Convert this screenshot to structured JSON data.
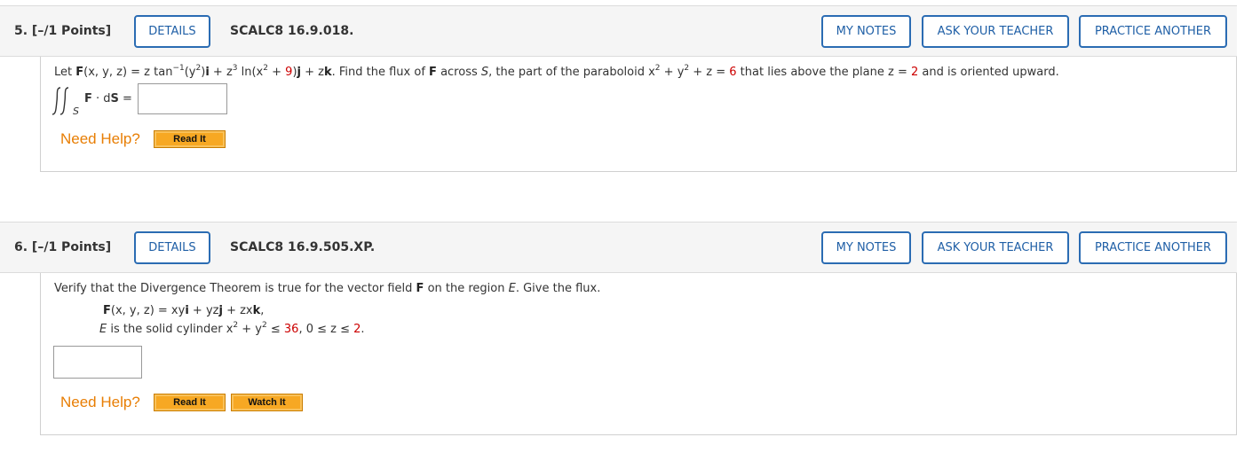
{
  "q5": {
    "number": "5.  [–/1 Points]",
    "details": "DETAILS",
    "id": "SCALC8 16.9.018.",
    "my_notes": "MY NOTES",
    "ask_teacher": "ASK YOUR TEACHER",
    "practice": "PRACTICE ANOTHER",
    "text": {
      "let": "Let ",
      "F": "F",
      "args": "(x, y, z) = z tan",
      "sup_m1": "−1",
      "y2a": "(y",
      "sup2": "2",
      "after_y2": ")",
      "i": "i",
      "plus_z": " + z",
      "sup3": "3",
      "ln": " ln(x",
      "plus": " + ",
      "nine": "9",
      "close": ")",
      "j": "j",
      "plus_z2": " + z",
      "k": "k",
      "find": ".  Find the flux of ",
      "F2": "F",
      "across": " across ",
      "S": "S",
      "part": ", the part of the paraboloid  x",
      "plus_y": " + y",
      "plus_z3": " + z = ",
      "six": "6",
      "lies": "  that lies above the plane  z = ",
      "two": "2",
      "oriented": "  and is oriented upward."
    },
    "integral_sub": "S",
    "integral_F": "F",
    "integral_dot": " · d",
    "integral_S": "S",
    "integral_eq": " =",
    "answer_value": "",
    "need_help": "Need Help?",
    "read_it": "Read It"
  },
  "q6": {
    "number": "6.  [–/1 Points]",
    "details": "DETAILS",
    "id": "SCALC8 16.9.505.XP.",
    "my_notes": "MY NOTES",
    "ask_teacher": "ASK YOUR TEACHER",
    "practice": "PRACTICE ANOTHER",
    "intro_a": "Verify that the Divergence Theorem is true for the vector field ",
    "intro_F": "F",
    "intro_b": " on the region ",
    "intro_E": "E",
    "intro_c": ". Give the flux.",
    "field": {
      "F": "F",
      "eq": "(x, y, z) = xy",
      "i": "i",
      "mid": " + yz",
      "j": "j",
      "mid2": " + zx",
      "k": "k",
      "end": ","
    },
    "region": {
      "E": "E",
      "is": " is the solid cylinder  x",
      "plus_y": " + y",
      "le": " ≤ ",
      "r": "36",
      "z_range_a": ",  0 ≤ z ≤ ",
      "h": "2",
      "end": "."
    },
    "answer_value": "",
    "need_help": "Need Help?",
    "read_it": "Read It",
    "watch_it": "Watch It"
  },
  "colors": {
    "accent_blue": "#1f5fa6",
    "help_orange": "#e87e04",
    "value_red": "#cc0000",
    "button_orange": "#f7a823"
  }
}
